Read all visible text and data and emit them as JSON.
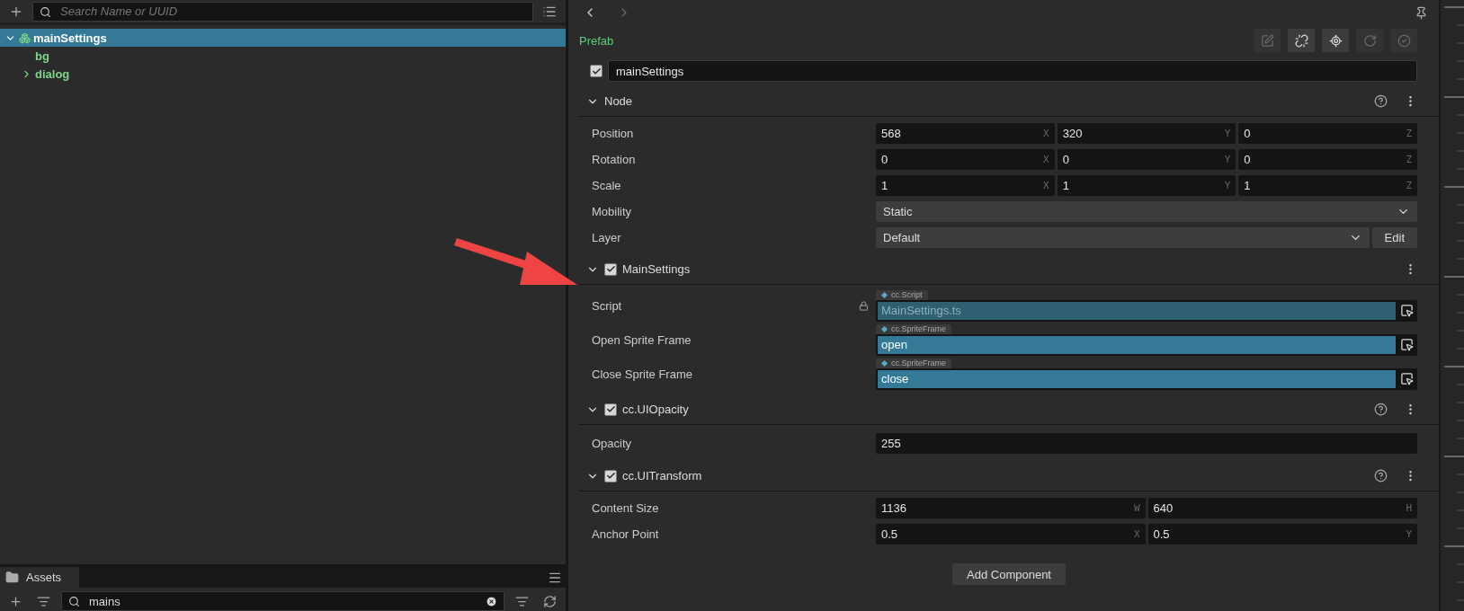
{
  "hierarchy": {
    "search": {
      "placeholder": "Search Name or UUID"
    },
    "tree": [
      {
        "name": "mainSettings",
        "kind": "group",
        "expanded": true,
        "selected": true,
        "children": [
          {
            "name": "bg",
            "kind": "leaf",
            "selected": false
          },
          {
            "name": "dialog",
            "kind": "group",
            "expanded": false,
            "selected": false
          }
        ]
      }
    ]
  },
  "assets": {
    "tab": "Assets",
    "search": {
      "value": "mains"
    }
  },
  "inspector": {
    "asset_type": "Prefab",
    "toolbar": [
      {
        "disabled": true
      },
      {
        "disabled": false
      },
      {
        "disabled": false
      },
      {
        "disabled": true
      },
      {
        "disabled": true
      }
    ],
    "node": {
      "active": true,
      "name": "mainSettings"
    },
    "sections": [
      {
        "kind": "node",
        "title": "Node",
        "help": true,
        "properties": [
          {
            "kind": "vector",
            "label": "Position",
            "fields": [
              {
                "value": "568",
                "axis": "X"
              },
              {
                "value": "320",
                "axis": "Y"
              },
              {
                "value": "0",
                "axis": "Z"
              }
            ]
          },
          {
            "kind": "vector",
            "label": "Rotation",
            "fields": [
              {
                "value": "0",
                "axis": "X"
              },
              {
                "value": "0",
                "axis": "Y"
              },
              {
                "value": "0",
                "axis": "Z"
              }
            ]
          },
          {
            "kind": "vector",
            "label": "Scale",
            "fields": [
              {
                "value": "1",
                "axis": "X"
              },
              {
                "value": "1",
                "axis": "Y"
              },
              {
                "value": "1",
                "axis": "Z"
              }
            ]
          },
          {
            "kind": "select",
            "label": "Mobility",
            "value": "Static"
          },
          {
            "kind": "select",
            "label": "Layer",
            "value": "Default",
            "button": "Edit"
          }
        ]
      },
      {
        "kind": "component",
        "title": "MainSettings",
        "enabled": true,
        "help": false,
        "properties": [
          {
            "kind": "asset",
            "label": "Script",
            "type": "cc.Script",
            "value": "MainSettings.ts",
            "locked": true
          },
          {
            "kind": "asset",
            "label": "Open Sprite Frame",
            "type": "cc.SpriteFrame",
            "value": "open",
            "locked": false
          },
          {
            "kind": "asset",
            "label": "Close Sprite Frame",
            "type": "cc.SpriteFrame",
            "value": "close",
            "locked": false
          }
        ]
      },
      {
        "kind": "component",
        "title": "cc.UIOpacity",
        "enabled": true,
        "help": true,
        "properties": [
          {
            "kind": "number",
            "label": "Opacity",
            "value": "255"
          }
        ]
      },
      {
        "kind": "component",
        "title": "cc.UITransform",
        "enabled": true,
        "help": true,
        "properties": [
          {
            "kind": "vector",
            "label": "Content Size",
            "fields": [
              {
                "value": "1136",
                "axis": "W"
              },
              {
                "value": "640",
                "axis": "H"
              }
            ]
          },
          {
            "kind": "vector",
            "label": "Anchor Point",
            "fields": [
              {
                "value": "0.5",
                "axis": "X"
              },
              {
                "value": "0.5",
                "axis": "Y"
              }
            ]
          }
        ]
      }
    ],
    "add_button": "Add Component"
  }
}
